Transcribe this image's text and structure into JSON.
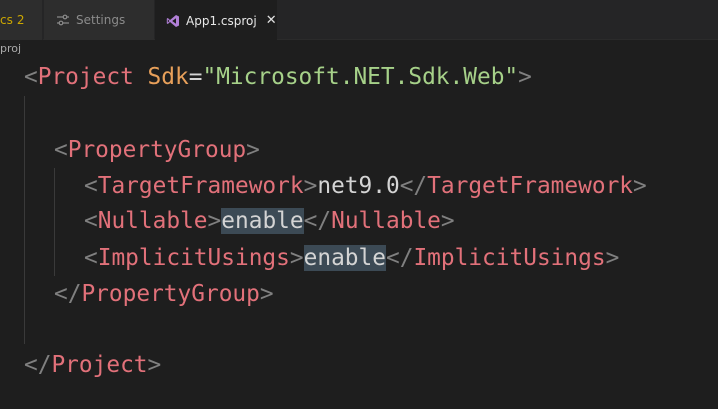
{
  "tabs": [
    {
      "label": "cs",
      "count": "2"
    },
    {
      "label": "Settings",
      "icon": "settings-sliders-icon"
    },
    {
      "label": "App1.csproj",
      "icon": "visual-studio-icon",
      "close": "✕",
      "active": true
    }
  ],
  "breadcrumb": "proj",
  "code": {
    "project_open": {
      "open": "<",
      "tag": "Project",
      "attr": "Sdk",
      "eq": "=",
      "value": "\"Microsoft.NET.Sdk.Web\"",
      "close": ">"
    },
    "pg_open": {
      "open": "<",
      "tag": "PropertyGroup",
      "close": ">"
    },
    "tf": {
      "open": "<",
      "tag": "TargetFramework",
      "close": ">",
      "text": "net9.0",
      "end_open": "</",
      "end_tag": "TargetFramework",
      "end_close": ">"
    },
    "nullable": {
      "open": "<",
      "tag": "Nullable",
      "close": ">",
      "text": "enable",
      "end_open": "</",
      "end_tag": "Nullable",
      "end_close": ">"
    },
    "iu": {
      "open": "<",
      "tag": "ImplicitUsings",
      "close": ">",
      "text": "enable",
      "end_open": "</",
      "end_tag": "ImplicitUsings",
      "end_close": ">"
    },
    "pg_close": {
      "open": "</",
      "tag": "PropertyGroup",
      "close": ">"
    },
    "project_close": {
      "open": "</",
      "tag": "Project",
      "close": ">"
    }
  },
  "colors": {
    "background": "#1e1e1e",
    "tag": "#e2717a",
    "attribute": "#e8a05a",
    "string": "#a6d189",
    "highlight": "#3c4a55"
  }
}
